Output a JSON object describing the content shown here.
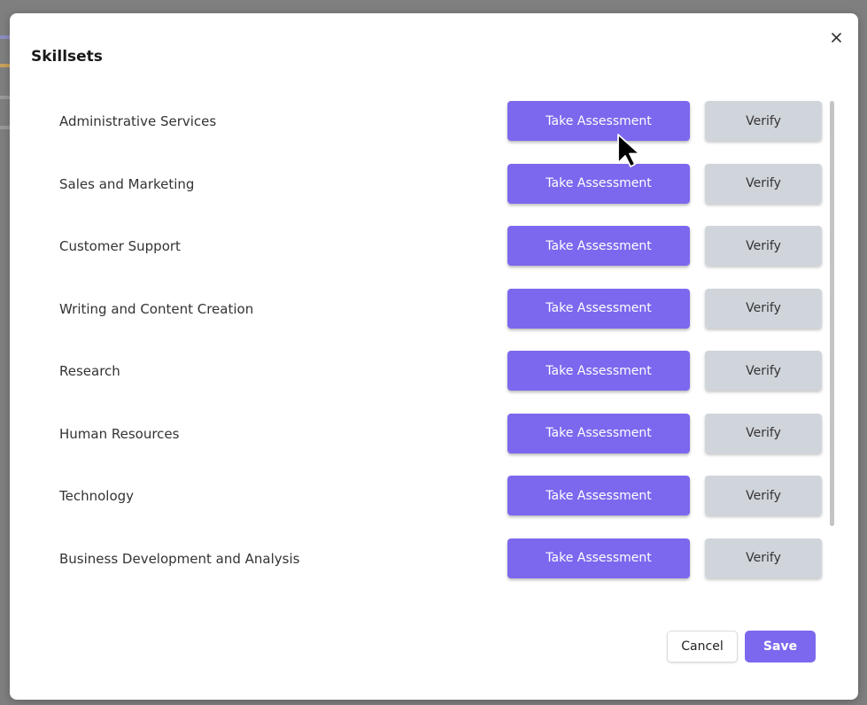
{
  "modal": {
    "title": "Skillsets",
    "close_icon": "close-icon"
  },
  "colors": {
    "accent": "#7b68ee",
    "verify_bg": "#d0d4db",
    "overlay": "#7f7f7f"
  },
  "skills": [
    {
      "label": "Administrative Services",
      "assess_label": "Take Assessment",
      "verify_label": "Verify"
    },
    {
      "label": "Sales and Marketing",
      "assess_label": "Take Assessment",
      "verify_label": "Verify"
    },
    {
      "label": "Customer Support",
      "assess_label": "Take Assessment",
      "verify_label": "Verify"
    },
    {
      "label": "Writing and Content Creation",
      "assess_label": "Take Assessment",
      "verify_label": "Verify"
    },
    {
      "label": "Research",
      "assess_label": "Take Assessment",
      "verify_label": "Verify"
    },
    {
      "label": "Human Resources",
      "assess_label": "Take Assessment",
      "verify_label": "Verify"
    },
    {
      "label": "Technology",
      "assess_label": "Take Assessment",
      "verify_label": "Verify"
    },
    {
      "label": "Business Development and Analysis",
      "assess_label": "Take Assessment",
      "verify_label": "Verify"
    }
  ],
  "footer": {
    "cancel_label": "Cancel",
    "save_label": "Save"
  }
}
